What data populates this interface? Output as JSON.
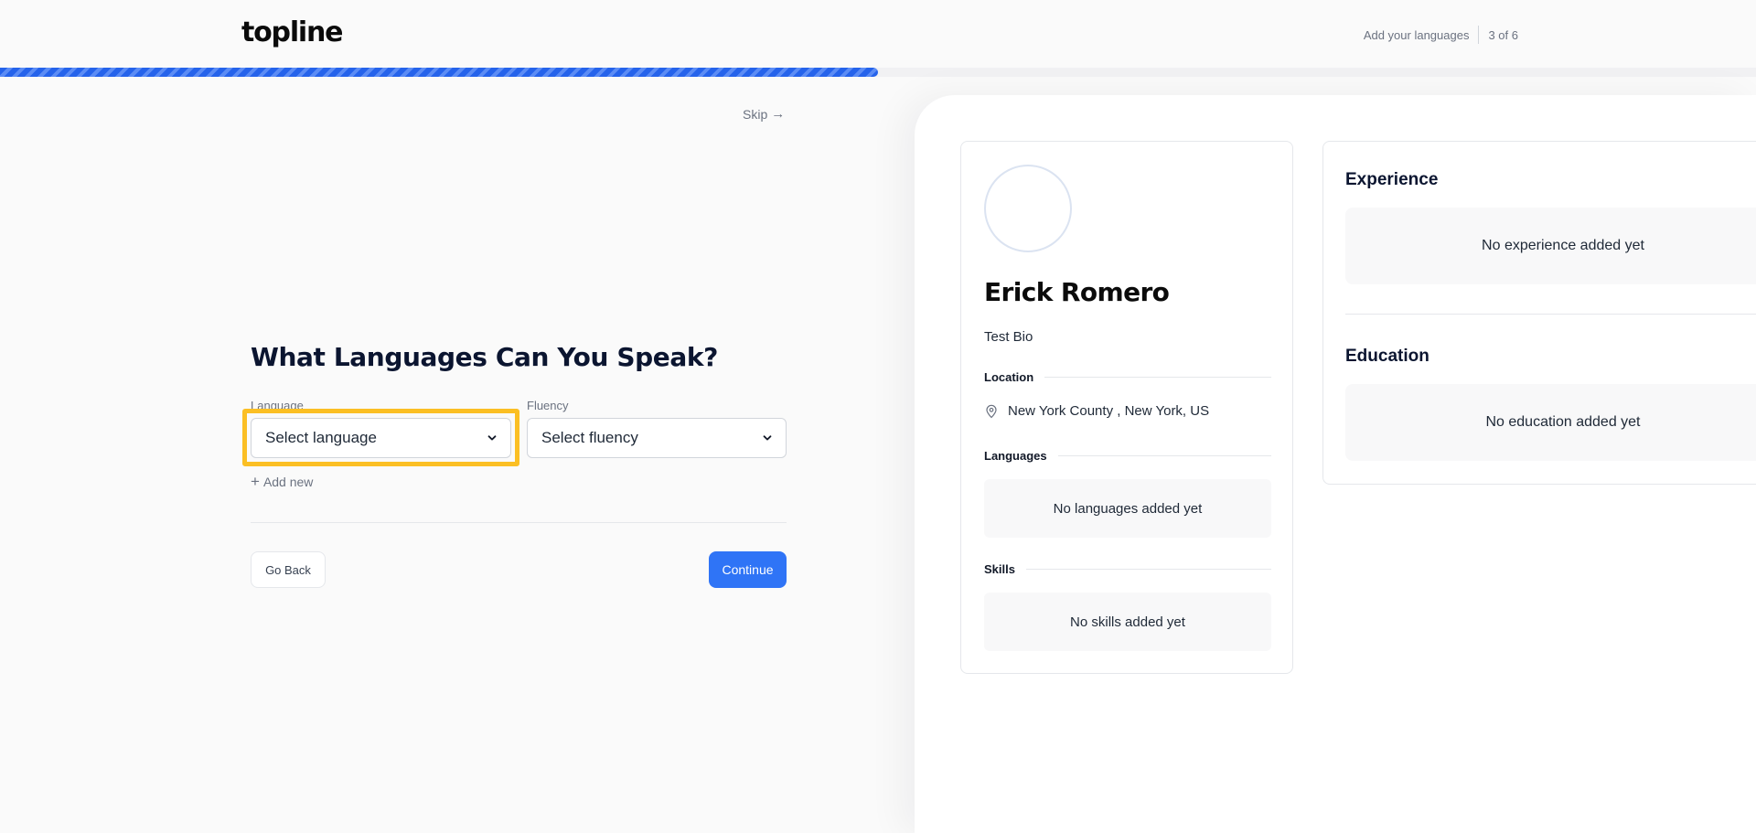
{
  "header": {
    "logo": "topline",
    "step_label": "Add your languages",
    "step_counter": "3 of 6",
    "progress_fraction": 0.5
  },
  "form": {
    "skip_label": "Skip",
    "title": "What Languages Can You Speak?",
    "language_label": "Language",
    "language_placeholder": "Select language",
    "fluency_label": "Fluency",
    "fluency_placeholder": "Select fluency",
    "add_new_label": "Add new",
    "back_label": "Go Back",
    "continue_label": "Continue"
  },
  "profile": {
    "name": "Erick Romero",
    "bio": "Test Bio",
    "location_heading": "Location",
    "location": "New York County , New York, US",
    "languages_heading": "Languages",
    "languages_empty": "No languages added yet",
    "skills_heading": "Skills",
    "skills_empty": "No skills added yet"
  },
  "details": {
    "experience_heading": "Experience",
    "experience_empty": "No experience added yet",
    "education_heading": "Education",
    "education_empty": "No education added yet"
  },
  "colors": {
    "accent": "#2f74f6",
    "progress": "#2563eb",
    "highlight": "#fbbf24"
  }
}
